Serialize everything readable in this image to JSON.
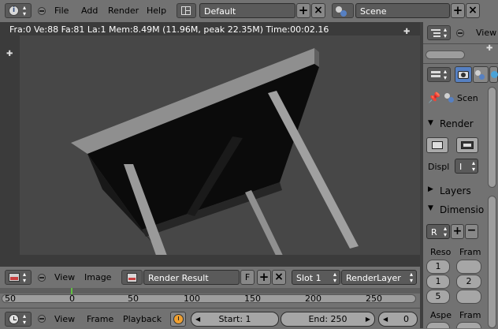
{
  "top_header": {
    "menus": [
      "File",
      "Add",
      "Render",
      "Help"
    ],
    "layout_name": "Default",
    "scene_name": "Scene"
  },
  "viewport": {
    "stats": "Fra:0  Ve:88 Fa:81 La:1 Mem:8.49M (11.96M, peak 22.35M) Time:00:02.16"
  },
  "image_header": {
    "view_label": "View",
    "image_label": "Image",
    "image_name": "Render Result",
    "fake_user_label": "F",
    "slot": "Slot 1",
    "layer": "RenderLayer"
  },
  "timeline": {
    "ticks": [
      "50",
      "0",
      "50",
      "100",
      "150",
      "200",
      "250"
    ],
    "current_frame_marker": 0
  },
  "timeline_header": {
    "view_label": "View",
    "frame_label": "Frame",
    "playback_label": "Playback",
    "start": "Start: 1",
    "end": "End: 250",
    "current": "0"
  },
  "outliner_header": {
    "view_label": "View"
  },
  "properties": {
    "context_scene": "Scen",
    "render_panel": "Render",
    "display_label": "Displ",
    "display_value": "I",
    "layers_panel": "Layers",
    "dimensions_panel": "Dimensio",
    "preset_value": "R",
    "resolution_label": "Reso",
    "frame_label": "Fram",
    "res_x": "1",
    "res_y": "1",
    "res_pct": "5",
    "frame_start": "1",
    "frame_end": "2",
    "aspect_label": "Aspe",
    "frame_rate_label": "Fram"
  },
  "colors": {
    "header_bg": "#727272",
    "viewport_bg": "#3b3b3b",
    "render_bg": "#474747",
    "accent_blue": "#5680c2",
    "playhead_green": "#60c040"
  }
}
